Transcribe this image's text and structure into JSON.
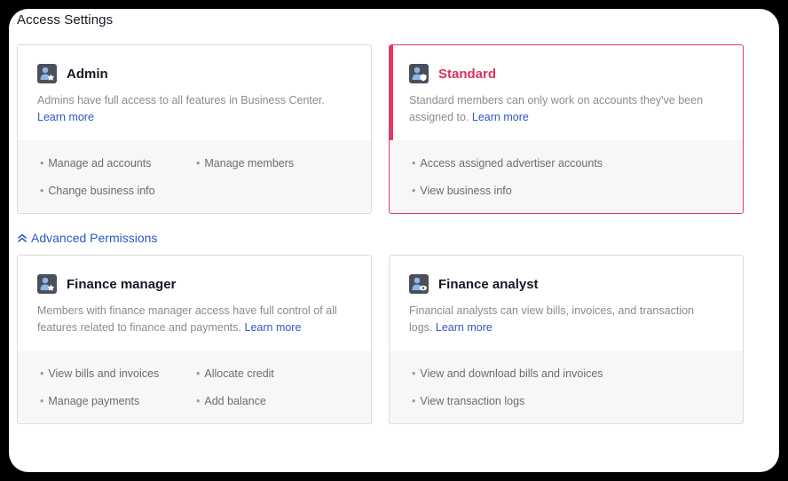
{
  "section_title": "Access Settings",
  "advanced": {
    "label": "Advanced Permissions",
    "icon": "chevron-double-up-icon"
  },
  "colors": {
    "accent": "#e03a68",
    "link": "#2f56c4",
    "icon_bg": "#4b4f5a"
  },
  "cards": [
    {
      "title": "Admin",
      "icon": "user-star-icon",
      "selected": false,
      "description": "Admins have full access to all features in Business Center.",
      "link": "Learn more",
      "permissions": [
        "Manage ad accounts",
        "Manage members",
        "Change business info"
      ]
    },
    {
      "title": "Standard",
      "icon": "user-shield-icon",
      "selected": true,
      "description": "Standard members can only work on accounts they've been assigned to.",
      "link": "Learn more",
      "permissions": [
        "Access assigned advertiser accounts",
        "View business info"
      ]
    },
    {
      "title": "Finance manager",
      "icon": "user-star-icon",
      "selected": false,
      "description": "Members with finance manager access have full control of all features related to finance and payments.",
      "link": "Learn more",
      "permissions": [
        "View bills and invoices",
        "Allocate credit",
        "Manage payments",
        "Add balance"
      ]
    },
    {
      "title": "Finance analyst",
      "icon": "user-eye-icon",
      "selected": false,
      "description": "Financial analysts can view bills, invoices, and transaction logs.",
      "link": "Learn more",
      "permissions": [
        "View and download bills and invoices",
        "View transaction logs"
      ]
    }
  ]
}
